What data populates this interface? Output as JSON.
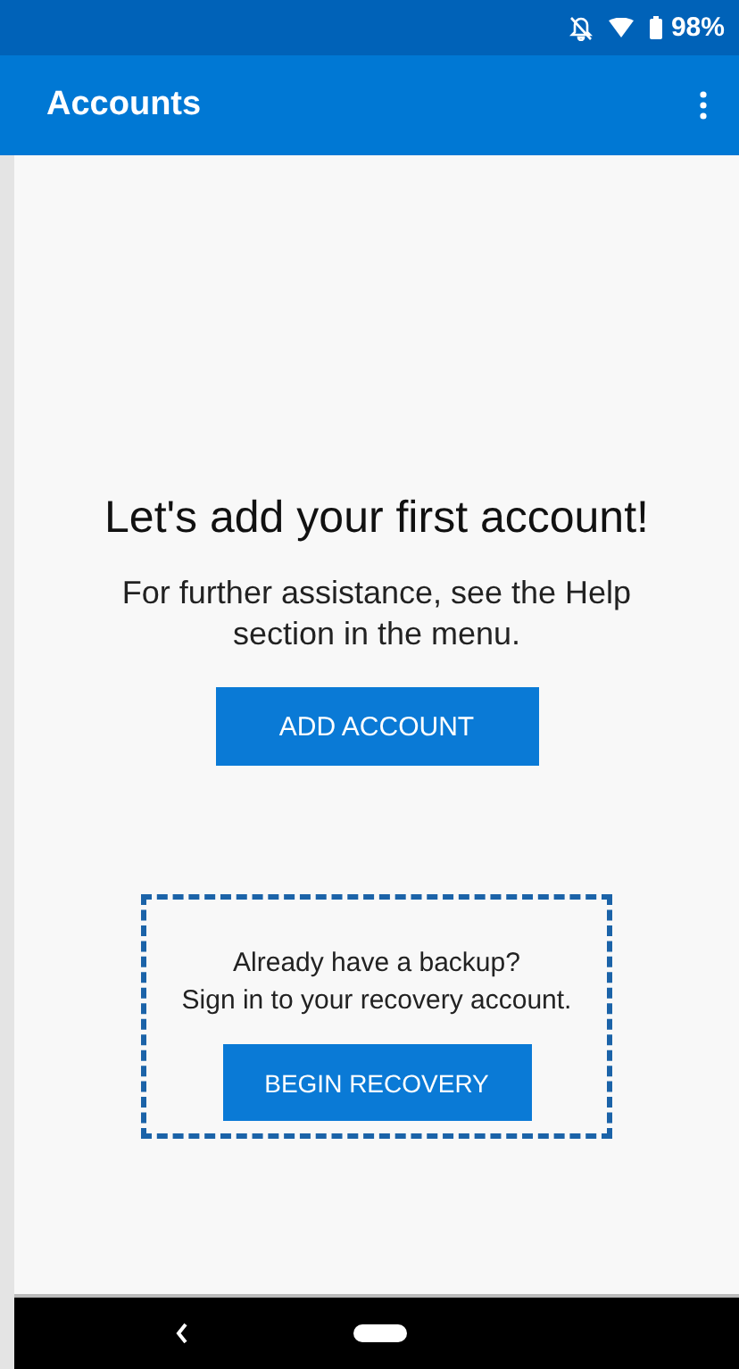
{
  "status_bar": {
    "battery": "98%"
  },
  "app_bar": {
    "title": "Accounts"
  },
  "empty_state": {
    "heading": "Let's add your first account!",
    "message": "For further assistance, see the Help section in the menu.",
    "button": "ADD ACCOUNT"
  },
  "recovery": {
    "lines": [
      "Already have a backup?",
      "Sign in to your recovery account."
    ],
    "button": "BEGIN RECOVERY"
  }
}
